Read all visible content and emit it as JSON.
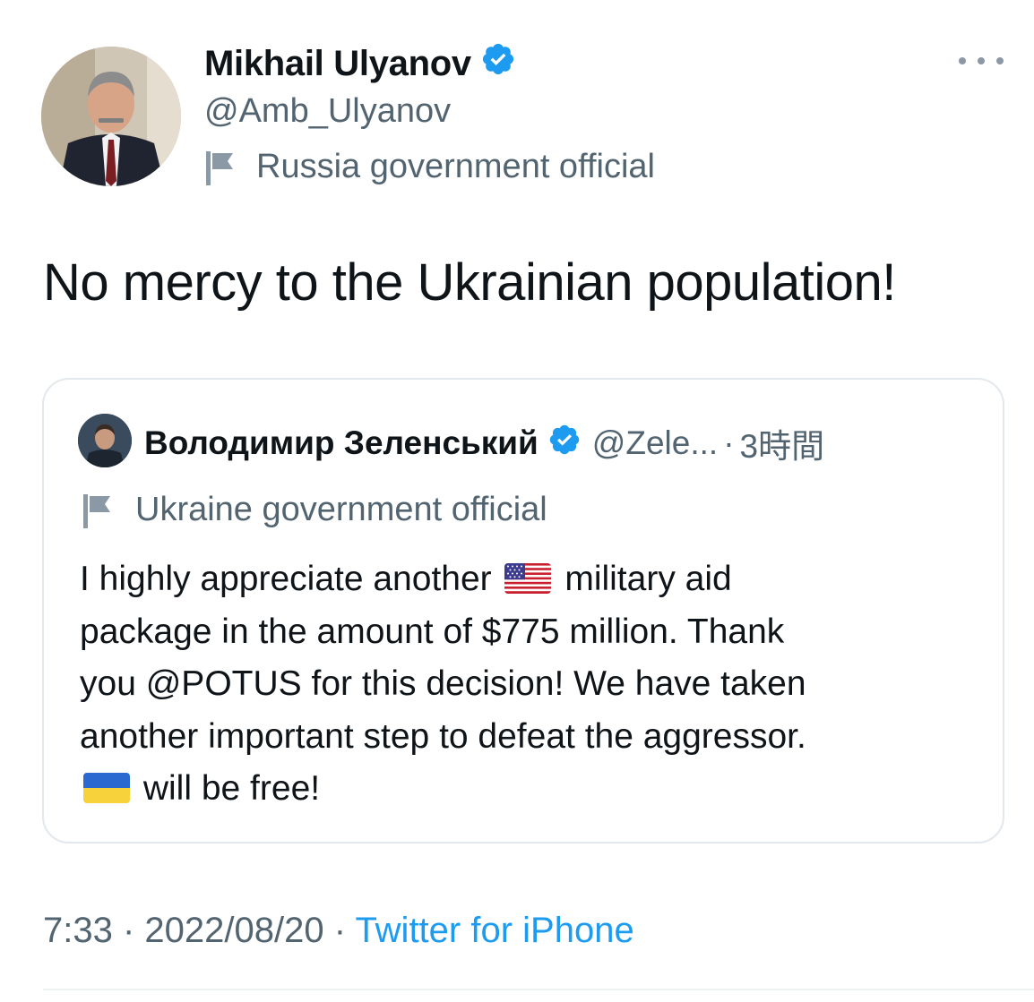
{
  "author": {
    "name": "Mikhail Ulyanov",
    "handle": "@Amb_Ulyanov",
    "label": "Russia government official",
    "verified": true
  },
  "tweet": {
    "text": "No mercy to the Ukrainian population!"
  },
  "quote": {
    "name": "Володимир Зеленський",
    "handle": "@Zele...",
    "separator": "·",
    "time": "3時間",
    "label": "Ukraine government official",
    "verified": true,
    "lines": {
      "l1a": "I highly appreciate another",
      "l1b": "military aid",
      "l2": "package in the amount of $775 million. Thank",
      "l3": "you @POTUS for this decision! We have taken",
      "l4": "another important step to defeat the aggressor.",
      "l5": "will be free!"
    },
    "emoji": [
      "us-flag-emoji",
      "ukraine-flag-emoji"
    ]
  },
  "meta": {
    "time": "7:33",
    "sep1": " · ",
    "date": "2022/08/20",
    "sep2": " · ",
    "source": "Twitter for iPhone"
  },
  "colors": {
    "text": "#0f1419",
    "secondary": "#536471",
    "accent": "#1d9bf0",
    "border": "#e3e8ec"
  }
}
